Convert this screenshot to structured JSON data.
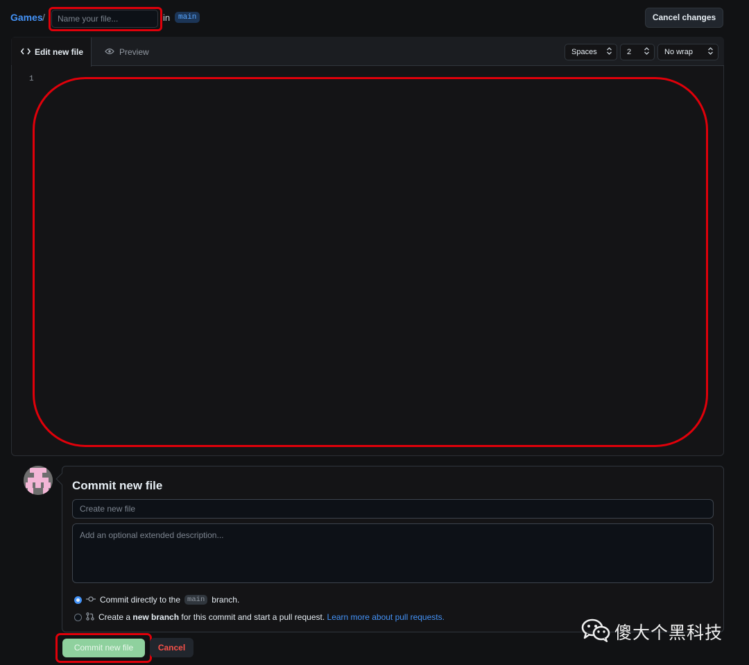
{
  "header": {
    "repo_name": "Games",
    "separator": "/",
    "filename_placeholder": "Name your file...",
    "in_label": "in",
    "branch": "main",
    "cancel_changes_label": "Cancel changes"
  },
  "editor": {
    "tabs": [
      {
        "label": "Edit new file",
        "icon": "code-icon",
        "active": true
      },
      {
        "label": "Preview",
        "icon": "eye-icon",
        "active": false
      }
    ],
    "indent_mode": "Spaces",
    "indent_size": "2",
    "wrap_mode": "No wrap",
    "line_numbers": [
      "1"
    ],
    "content": ""
  },
  "commit": {
    "title": "Commit new file",
    "message_placeholder": "Create new file",
    "description_placeholder": "Add an optional extended description...",
    "option_direct": {
      "prefix": "Commit directly to the",
      "branch": "main",
      "suffix": "branch.",
      "selected": true,
      "icon": "git-commit-icon"
    },
    "option_branch": {
      "prefix": "Create a",
      "bold": "new branch",
      "suffix": "for this commit and start a pull request.",
      "link": "Learn more about pull requests.",
      "selected": false,
      "icon": "git-pull-request-icon"
    },
    "commit_button_label": "Commit new file",
    "cancel_button_label": "Cancel"
  },
  "watermark": {
    "text": "傻大个黑科技",
    "icon": "wechat-icon"
  },
  "colors": {
    "accent": "#4493f8",
    "highlight": "#e0000a",
    "commit_button": "#8fd19e",
    "danger": "#f85149"
  }
}
